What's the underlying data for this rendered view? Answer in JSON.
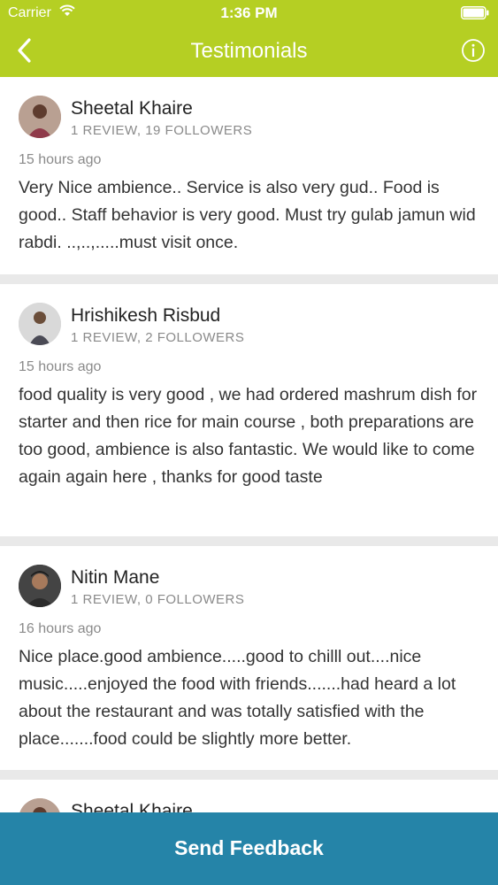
{
  "status_bar": {
    "carrier": "Carrier",
    "time": "1:36 PM"
  },
  "nav": {
    "title": "Testimonials",
    "back_icon": "chevron-left-icon",
    "info_icon": "info-icon"
  },
  "colors": {
    "header": "#b5cf23",
    "footer": "#2584a8",
    "background": "#e9e9e9"
  },
  "reviews": [
    {
      "name": "Sheetal Khaire",
      "stats": "1 REVIEW, 19 FOLLOWERS",
      "time": "15 hours ago",
      "text": "Very Nice  ambience.. Service is also very gud.. Food is good.. Staff behavior is very good. Must try gulab jamun wid rabdi. ..,..,.....must visit once."
    },
    {
      "name": "Hrishikesh Risbud",
      "stats": "1 REVIEW, 2 FOLLOWERS",
      "time": "15 hours ago",
      "text": "food quality is very good , we had ordered mashrum dish for starter and then rice for main course , both preparations are too good, ambience is also fantastic. We would like to come again again here , thanks for good taste"
    },
    {
      "name": "Nitin Mane",
      "stats": "1 REVIEW, 0 FOLLOWERS",
      "time": "16 hours ago",
      "text": "Nice place.good ambience.....good to chilll out....nice music.....enjoyed the food with friends.......had heard a lot about the restaurant  and was totally satisfied with the place.......food could be slightly more better."
    },
    {
      "name": "Sheetal Khaire"
    }
  ],
  "footer": {
    "label": "Send Feedback"
  }
}
